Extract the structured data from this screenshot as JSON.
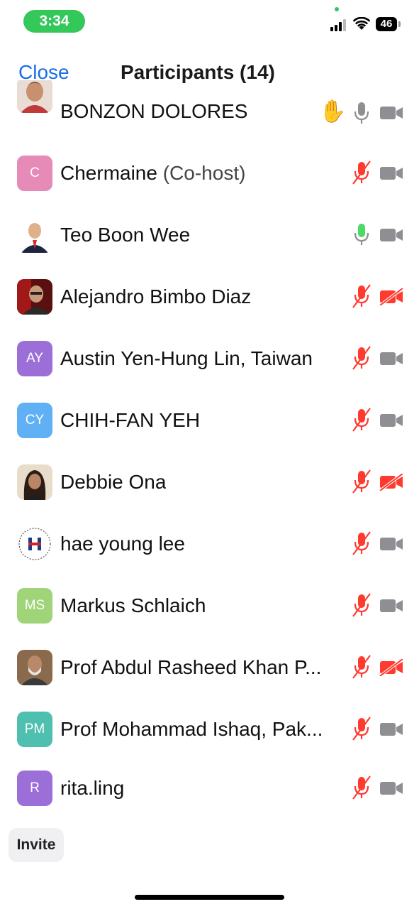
{
  "status_bar": {
    "time": "3:34",
    "battery": "46"
  },
  "header": {
    "close_label": "Close",
    "title": "Participants (14)"
  },
  "participants": [
    {
      "name": "BONZON DOLORES",
      "avatar_initials": "",
      "avatar_type": "photo",
      "raised_hand": true,
      "mic": "on",
      "video": "off-gray"
    },
    {
      "name": "Chermaine",
      "suffix": "(Co-host)",
      "avatar_initials": "C",
      "avatar_color": "#e68ab7",
      "mic": "muted",
      "video": "gray"
    },
    {
      "name": "Teo Boon Wee",
      "avatar_initials": "",
      "avatar_type": "photo",
      "mic": "talking",
      "video": "gray"
    },
    {
      "name": "Alejandro Bimbo Diaz",
      "avatar_initials": "",
      "avatar_type": "photo",
      "mic": "muted",
      "video": "off"
    },
    {
      "name": "Austin Yen-Hung Lin, Taiwan",
      "avatar_initials": "AY",
      "avatar_color": "#9c6fd8",
      "mic": "muted",
      "video": "gray"
    },
    {
      "name": "CHIH-FAN YEH",
      "avatar_initials": "CY",
      "avatar_color": "#5fb0f4",
      "mic": "muted",
      "video": "gray"
    },
    {
      "name": "Debbie Ona",
      "avatar_initials": "",
      "avatar_type": "photo",
      "mic": "muted",
      "video": "off"
    },
    {
      "name": "hae young lee",
      "avatar_initials": "",
      "avatar_type": "logo",
      "mic": "muted",
      "video": "gray"
    },
    {
      "name": "Markus Schlaich",
      "avatar_initials": "MS",
      "avatar_color": "#9fd478",
      "mic": "muted",
      "video": "gray"
    },
    {
      "name": "Prof Abdul Rasheed Khan P...",
      "avatar_initials": "",
      "avatar_type": "photo",
      "mic": "muted",
      "video": "off"
    },
    {
      "name": "Prof Mohammad Ishaq, Pak...",
      "avatar_initials": "PM",
      "avatar_color": "#4fbfb0",
      "mic": "muted",
      "video": "gray"
    },
    {
      "name": "rita.ling",
      "avatar_initials": "R",
      "avatar_color": "#9c6fd8",
      "mic": "muted",
      "video": "gray"
    }
  ],
  "footer": {
    "invite_label": "Invite"
  }
}
